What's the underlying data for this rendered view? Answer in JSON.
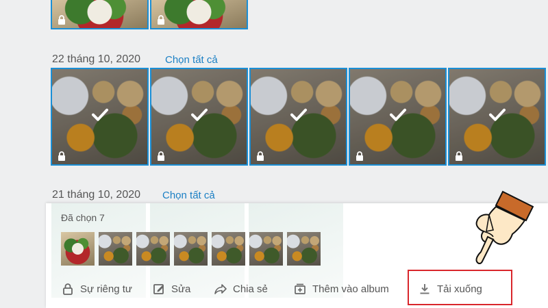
{
  "groups": [
    {
      "date": "22 tháng 10, 2020",
      "select_all": "Chọn tất cả"
    },
    {
      "date": "21 tháng 10, 2020",
      "select_all": "Chọn tất cả"
    }
  ],
  "selection_panel": {
    "count_label": "Đã chọn 7",
    "actions": {
      "privacy": "Sự riêng tư",
      "edit": "Sửa",
      "share": "Chia sẻ",
      "add_album": "Thêm vào album",
      "download": "Tải xuống"
    }
  },
  "colors": {
    "accent": "#1a8fd6",
    "link": "#1a7fc4",
    "highlight": "#d9262b"
  }
}
